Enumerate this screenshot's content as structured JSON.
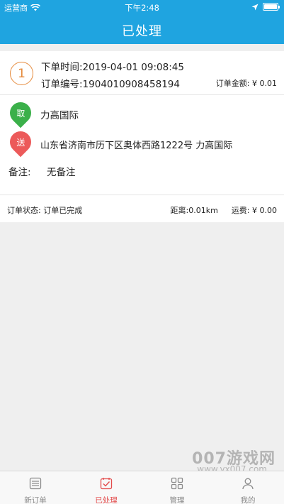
{
  "status_bar": {
    "carrier": "运营商",
    "time": "下午2:48"
  },
  "nav": {
    "title": "已处理"
  },
  "order": {
    "index": "1",
    "time_text": "下单时间:2019-04-01 09:08:45",
    "id_text": "订单编号:1904010908458194",
    "amount_text": "订单金额: ¥ 0.01",
    "pickup": {
      "badge": "取",
      "name": "力高国际"
    },
    "delivery": {
      "badge": "送",
      "address": "山东省济南市历下区奥体西路1222号 力高国际"
    },
    "remark_label": "备注:",
    "remark_value": "无备注",
    "status_text": "订单状态: 订单已完成",
    "distance_text": "距离:0.01km",
    "fee_text": "运费: ¥ 0.00"
  },
  "tabs": [
    {
      "label": "新订单",
      "icon": "list-icon"
    },
    {
      "label": "已处理",
      "icon": "checked-calendar-icon"
    },
    {
      "label": "管理",
      "icon": "grid-icon"
    },
    {
      "label": "我的",
      "icon": "person-icon"
    }
  ],
  "watermark": {
    "text": "007游戏网",
    "url": "www.yx007.com"
  },
  "colors": {
    "header": "#1fa4e0",
    "pickup_pin": "#3bb04a",
    "delivery_pin": "#ec5a5a",
    "index_circle": "#e58a3c",
    "active_tab": "#e34b4b"
  }
}
